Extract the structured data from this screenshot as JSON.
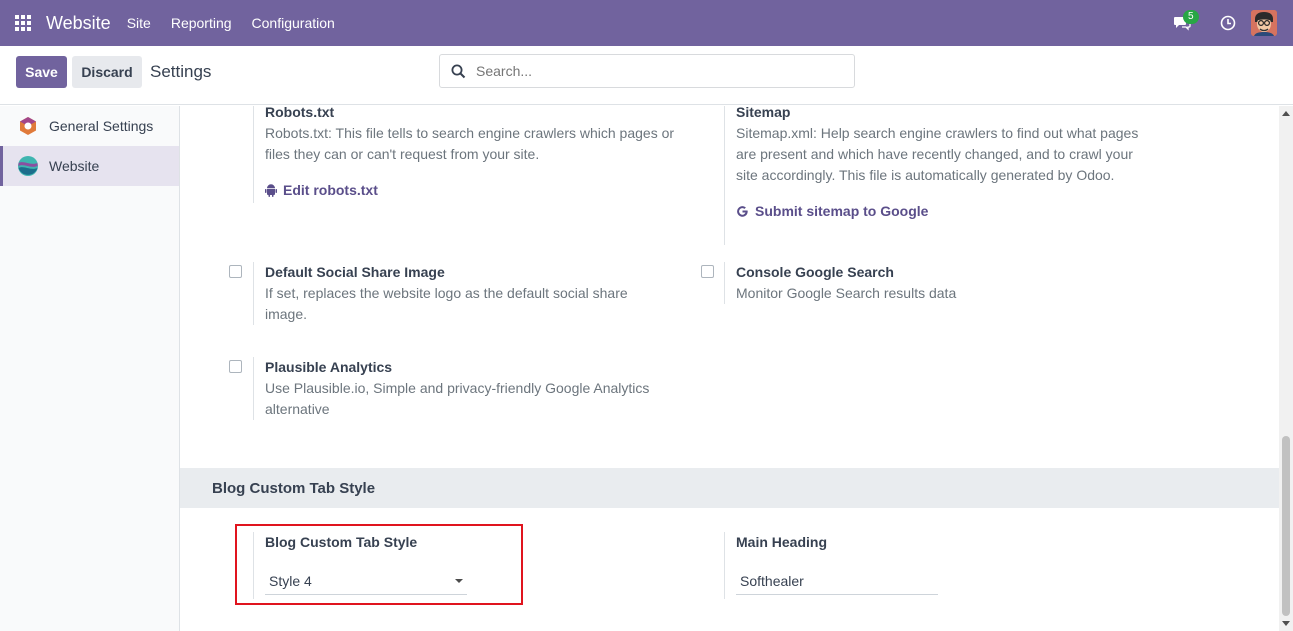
{
  "navbar": {
    "brand": "Website",
    "menu": [
      "Site",
      "Reporting",
      "Configuration"
    ],
    "chat_count": "5",
    "color": "#71639e"
  },
  "control": {
    "save_label": "Save",
    "discard_label": "Discard",
    "title": "Settings",
    "search_placeholder": "Search..."
  },
  "sidebar": {
    "items": [
      {
        "label": "General Settings",
        "icon": "odoo-settings-icon"
      },
      {
        "label": "Website",
        "icon": "website-app-icon",
        "active": true
      }
    ]
  },
  "settings": {
    "robots": {
      "title": "Robots.txt",
      "desc": "Robots.txt: This file tells to search engine crawlers which pages or files they can or can't request from your site.",
      "link": "Edit robots.txt"
    },
    "sitemap": {
      "title": "Sitemap",
      "desc": "Sitemap.xml: Help search engine crawlers to find out what pages are present and which have recently changed, and to crawl your site accordingly. This file is automatically generated by Odoo.",
      "link": "Submit sitemap to Google"
    },
    "social_image": {
      "title": "Default Social Share Image",
      "desc": "If set, replaces the website logo as the default social share image."
    },
    "console_google": {
      "title": "Console Google Search",
      "desc": "Monitor Google Search results data"
    },
    "plausible": {
      "title": "Plausible Analytics",
      "desc": "Use Plausible.io, Simple and privacy-friendly Google Analytics alternative"
    }
  },
  "blog_section": {
    "header": "Blog Custom Tab Style",
    "tab_style": {
      "title": "Blog Custom Tab Style",
      "value": "Style 4"
    },
    "main_heading": {
      "title": "Main Heading",
      "value": "Softhealer"
    }
  }
}
